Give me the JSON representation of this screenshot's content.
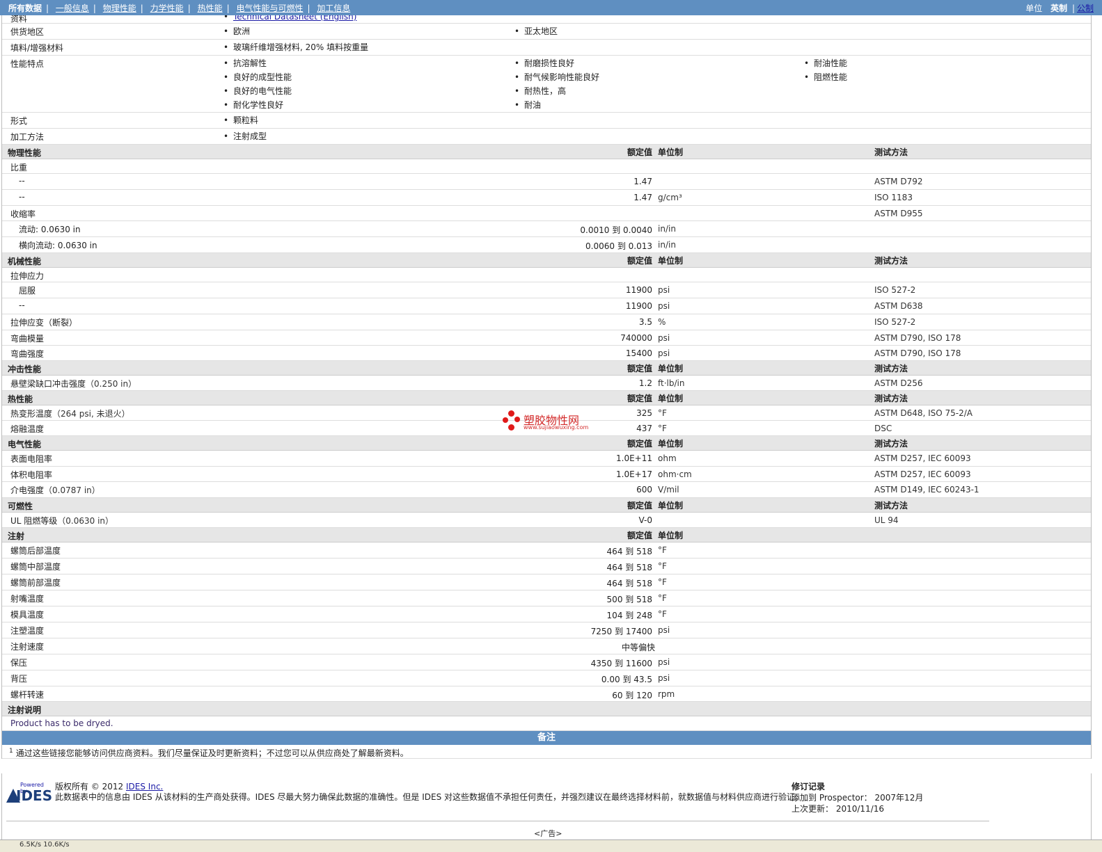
{
  "nav": {
    "items": [
      "所有数据",
      "一般信息",
      "物理性能",
      "力学性能",
      "热性能",
      "电气性能与可燃性",
      "加工信息"
    ],
    "units_label": "单位",
    "unit_options": [
      "英制",
      "公制"
    ]
  },
  "general": {
    "datasheet_label": "资料",
    "datasheet_link": "Technical Datasheet (English)",
    "supply_label": "供货地区",
    "supply": [
      "欧洲",
      "亚太地区"
    ],
    "filler_label": "填料/增强材料",
    "filler": "玻璃纤维增强材料, 20% 填料按重量",
    "features_label": "性能特点",
    "features_col1": [
      "抗溶解性",
      "良好的成型性能",
      "良好的电气性能",
      "耐化学性良好"
    ],
    "features_col2": [
      "耐磨损性良好",
      "耐气候影响性能良好",
      "耐热性，高",
      "耐油"
    ],
    "features_col3": [
      "耐油性能",
      "阻燃性能"
    ],
    "form_label": "形式",
    "form": "颗粒料",
    "process_label": "加工方法",
    "process": "注射成型"
  },
  "headers": {
    "nominal": "额定值",
    "unit": "单位制",
    "method": "测试方法"
  },
  "physical": {
    "title": "物理性能",
    "sg_label": "比重",
    "sg_rows": [
      {
        "label": "--",
        "value": "1.47",
        "unit": "",
        "method": "ASTM D792"
      },
      {
        "label": "--",
        "value": "1.47",
        "unit": "g/cm³",
        "method": "ISO 1183"
      }
    ],
    "shrink_label": "收缩率",
    "shrink_method": "ASTM D955",
    "shrink_rows": [
      {
        "label": "流动: 0.0630 in",
        "value": "0.0010 到  0.0040",
        "unit": "in/in"
      },
      {
        "label": "横向流动: 0.0630 in",
        "value": "0.0060 到  0.013",
        "unit": "in/in"
      }
    ]
  },
  "mechanical": {
    "title": "机械性能",
    "tensile_label": "拉伸应力",
    "tensile_rows": [
      {
        "label": "屈服",
        "value": "11900",
        "unit": "psi",
        "method": "ISO 527-2"
      },
      {
        "label": "--",
        "value": "11900",
        "unit": "psi",
        "method": "ASTM D638"
      }
    ],
    "rows": [
      {
        "label": "拉伸应变（断裂）",
        "value": "3.5",
        "unit": "%",
        "method": "ISO 527-2"
      },
      {
        "label": "弯曲模量",
        "value": "740000",
        "unit": "psi",
        "method": "ASTM D790, ISO 178"
      },
      {
        "label": "弯曲强度",
        "value": "15400",
        "unit": "psi",
        "method": "ASTM D790, ISO 178"
      }
    ]
  },
  "impact": {
    "title": "冲击性能",
    "rows": [
      {
        "label": "悬壁梁缺口冲击强度",
        "paren": "（0.250 in）",
        "value": "1.2",
        "unit": "ft·lb/in",
        "method": "ASTM D256"
      }
    ]
  },
  "thermal": {
    "title": "热性能",
    "rows": [
      {
        "label": "热变形温度",
        "paren": "（264 psi, 未退火）",
        "value": "325",
        "unit": "°F",
        "method": "ASTM D648, ISO 75-2/A"
      },
      {
        "label": "熔融温度",
        "paren": "",
        "value": "437",
        "unit": "°F",
        "method": "DSC"
      }
    ]
  },
  "electrical": {
    "title": "电气性能",
    "rows": [
      {
        "label": "表面电阻率",
        "paren": "",
        "value": "1.0E+11",
        "unit": "ohm",
        "method": "ASTM D257, IEC 60093"
      },
      {
        "label": "体积电阻率",
        "paren": "",
        "value": "1.0E+17",
        "unit": "ohm·cm",
        "method": "ASTM D257, IEC 60093"
      },
      {
        "label": "介电强度",
        "paren": "（0.0787 in）",
        "value": "600",
        "unit": "V/mil",
        "method": "ASTM D149, IEC 60243-1"
      }
    ]
  },
  "flammability": {
    "title": "可燃性",
    "rows": [
      {
        "label": "UL 阻燃等级",
        "paren": "（0.0630 in）",
        "value": "V-0",
        "unit": "",
        "method": "UL 94"
      }
    ]
  },
  "injection": {
    "title": "注射",
    "rows": [
      {
        "label": "螺筒后部温度",
        "value": "464 到  518",
        "unit": "°F"
      },
      {
        "label": "螺筒中部温度",
        "value": "464 到  518",
        "unit": "°F"
      },
      {
        "label": "螺筒前部温度",
        "value": "464 到  518",
        "unit": "°F"
      },
      {
        "label": "射嘴温度",
        "value": "500 到  518",
        "unit": "°F"
      },
      {
        "label": "模具温度",
        "value": "104 到  248",
        "unit": "°F"
      },
      {
        "label": "注塑温度",
        "value": "7250 到  17400",
        "unit": "psi"
      },
      {
        "label": "注射速度",
        "value": "中等偏快",
        "unit": ""
      },
      {
        "label": "保压",
        "value": "4350 到  11600",
        "unit": "psi"
      },
      {
        "label": "背压",
        "value": "0.00 到  43.5",
        "unit": "psi"
      },
      {
        "label": "螺杆转速",
        "value": "60 到  120",
        "unit": "rpm"
      }
    ]
  },
  "injection_notes": {
    "title": "注射说明",
    "text": "Product has to be dryed."
  },
  "notes": {
    "title": "备注",
    "footnote_mark": "1",
    "footnote": "通过这些链接您能够访问供应商资料。我们尽量保证及时更新资料；不过您可以从供应商处了解最新资料。"
  },
  "footer": {
    "powered_by": "Powered by",
    "logo_text": "IDES",
    "copyright_prefix": "版权所有  © 2012",
    "copyright_link": "IDES Inc.",
    "disclaimer": "此数据表中的信息由  IDES 从该材料的生产商处获得。IDES 尽最大努力确保此数据的准确性。但是  IDES 对这些数据值不承担任何责任，并强烈建议在最终选择材料前，就数据值与材料供应商进行验证。",
    "revision_title": "修订记录",
    "added_label": "添加到  Prospector：",
    "added_value": "2007年12月",
    "updated_label": "上次更新：",
    "updated_value": "2010/11/16",
    "ad": "<广告>"
  },
  "watermark": {
    "text": "塑胶物性网",
    "url": "www.sujiaowuxing.com"
  },
  "status": {
    "text": "6.5K/s   10.6K/s"
  }
}
